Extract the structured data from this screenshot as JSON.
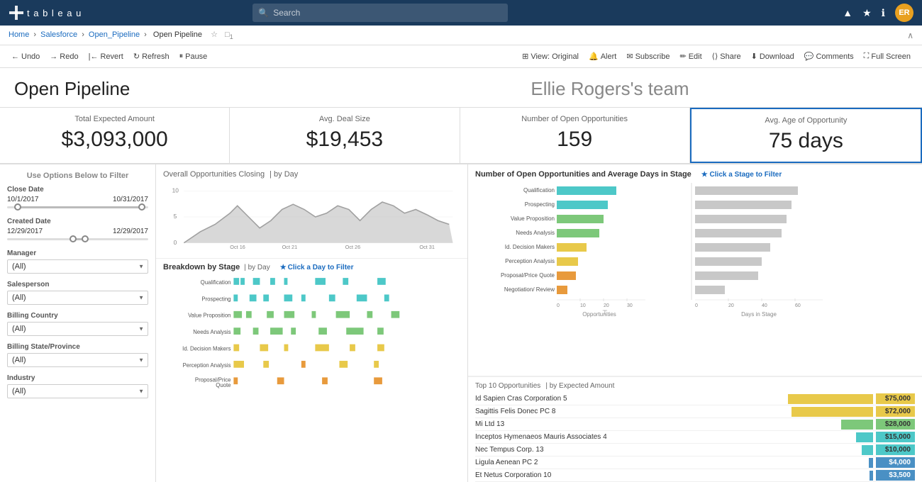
{
  "app": {
    "name": "tableau",
    "logo_text": "t a b l e a u"
  },
  "search": {
    "placeholder": "Search"
  },
  "nav_icons": {
    "alert": "▲",
    "star": "★",
    "info": "ℹ",
    "avatar_initials": "ER"
  },
  "breadcrumb": {
    "home": "Home",
    "salesforce": "Salesforce",
    "open_pipeline_link": "Open_Pipeline",
    "current": "Open Pipeline",
    "tab_count": "1"
  },
  "toolbar": {
    "undo": "Undo",
    "redo": "Redo",
    "revert": "Revert",
    "refresh": "Refresh",
    "pause": "Pause",
    "view_original": "View: Original",
    "alert": "Alert",
    "subscribe": "Subscribe",
    "edit": "Edit",
    "share": "Share",
    "download": "Download",
    "comments": "Comments",
    "full_screen": "Full Screen"
  },
  "dashboard": {
    "title": "Open Pipeline",
    "subtitle": "Ellie Rogers's team"
  },
  "kpis": [
    {
      "label": "Total Expected Amount",
      "value": "$3,093,000"
    },
    {
      "label": "Avg. Deal Size",
      "value": "$19,453"
    },
    {
      "label": "Number of Open Opportunities",
      "value": "159"
    },
    {
      "label": "Avg. Age of Opportunity",
      "value": "75 days"
    }
  ],
  "filters": {
    "title": "Use Options Below to Filter",
    "close_date": {
      "label": "Close Date",
      "start": "10/1/2017",
      "end": "10/31/2017"
    },
    "created_date": {
      "label": "Created Date",
      "start": "12/29/2017",
      "end": "12/29/2017"
    },
    "manager": {
      "label": "Manager",
      "value": "(All)"
    },
    "salesperson": {
      "label": "Salesperson",
      "value": "(All)"
    },
    "billing_country": {
      "label": "Billing Country",
      "value": "(All)"
    },
    "billing_state": {
      "label": "Billing State/Province",
      "value": "(All)"
    },
    "industry": {
      "label": "Industry",
      "value": "(All)"
    }
  },
  "overall_chart": {
    "title": "Overall Opportunities Closing",
    "subtitle": "| by Day",
    "x_labels": [
      "Oct 16",
      "Oct 21",
      "Oct 26",
      "Oct 31"
    ],
    "y_labels": [
      "0",
      "5",
      "10"
    ]
  },
  "breakdown_chart": {
    "title": "Breakdown by Stage",
    "subtitle": "| by Day",
    "filter_link": "★ Click a Day to Filter",
    "stages": [
      "Qualification",
      "Prospecting",
      "Value Proposition",
      "Needs Analysis",
      "Id. Decision Makers",
      "Perception Analysis",
      "Proposal/Price Quote"
    ]
  },
  "opportunities_chart": {
    "title": "Number of Open Opportunities and Average Days in Stage",
    "filter_link": "★ Click a Stage to Filter",
    "stages": [
      {
        "name": "Qualification",
        "opps": 28,
        "days": 62
      },
      {
        "name": "Prospecting",
        "opps": 24,
        "days": 58
      },
      {
        "name": "Value Proposition",
        "opps": 22,
        "days": 55
      },
      {
        "name": "Needs Analysis",
        "opps": 20,
        "days": 52
      },
      {
        "name": "Id. Decision Makers",
        "opps": 14,
        "days": 45
      },
      {
        "name": "Perception Analysis",
        "opps": 10,
        "days": 40
      },
      {
        "name": "Proposal/Price Quote",
        "opps": 9,
        "days": 38
      },
      {
        "name": "Negotiation/ Review",
        "opps": 5,
        "days": 18
      }
    ],
    "opps_axis": [
      "0",
      "10",
      "20",
      "30"
    ],
    "days_axis": [
      "0",
      "20",
      "40",
      "60"
    ],
    "opps_label": "Opportunities",
    "days_label": "Days in Stage"
  },
  "top10": {
    "title": "Top 10 Opportunities",
    "subtitle": "| by Expected Amount",
    "items": [
      {
        "name": "Id Sapien Cras Corporation 5",
        "value": "$75,000",
        "color": "#e8c94a"
      },
      {
        "name": "Sagittis Felis Donec PC 8",
        "value": "$72,000",
        "color": "#e8c94a"
      },
      {
        "name": "Mi Ltd 13",
        "value": "$28,000",
        "color": "#7dc87a"
      },
      {
        "name": "Inceptos Hymenaeos Mauris Associates 4",
        "value": "$15,000",
        "color": "#4dc8c8"
      },
      {
        "name": "Nec Tempus Corp. 13",
        "value": "$10,000",
        "color": "#4dc8c8"
      },
      {
        "name": "Ligula Aenean PC 2",
        "value": "$4,000",
        "color": "#4a90c4"
      },
      {
        "name": "Et Netus Corporation 10",
        "value": "$3,500",
        "color": "#4a90c4"
      }
    ]
  }
}
